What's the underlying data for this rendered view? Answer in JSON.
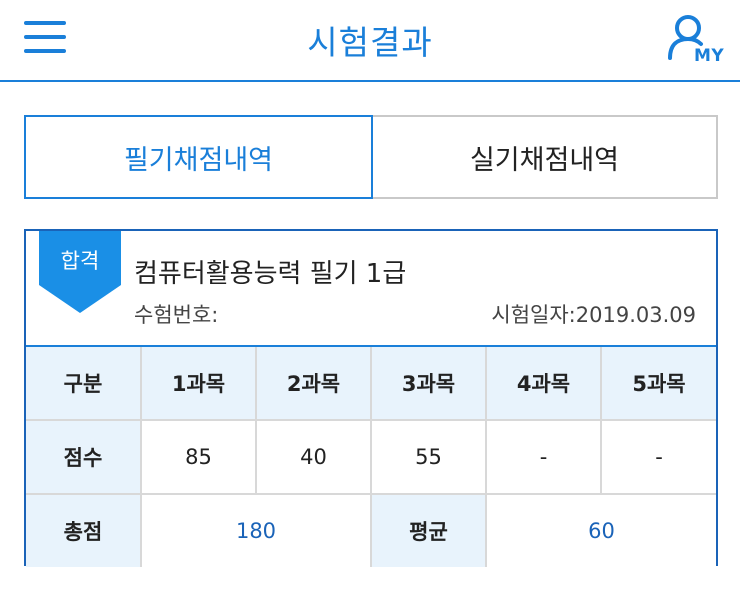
{
  "header": {
    "title": "시험결과",
    "my_label": "MY",
    "accent_color": "#1a7fd9"
  },
  "tabs": [
    {
      "label": "필기채점내역",
      "active": true
    },
    {
      "label": "실기채점내역",
      "active": false
    }
  ],
  "result": {
    "badge": "합격",
    "exam_name": "컴퓨터활용능력 필기 1급",
    "exam_number_label": "수험번호:",
    "exam_date_label": "시험일자:2019.03.09"
  },
  "score_table": {
    "header_label": "구분",
    "subjects": [
      "1과목",
      "2과목",
      "3과목",
      "4과목",
      "5과목"
    ],
    "score_label": "점수",
    "scores": [
      "85",
      "40",
      "55",
      "-",
      "-"
    ],
    "total_label": "총점",
    "total_value": "180",
    "average_label": "평균",
    "average_value": "60"
  }
}
